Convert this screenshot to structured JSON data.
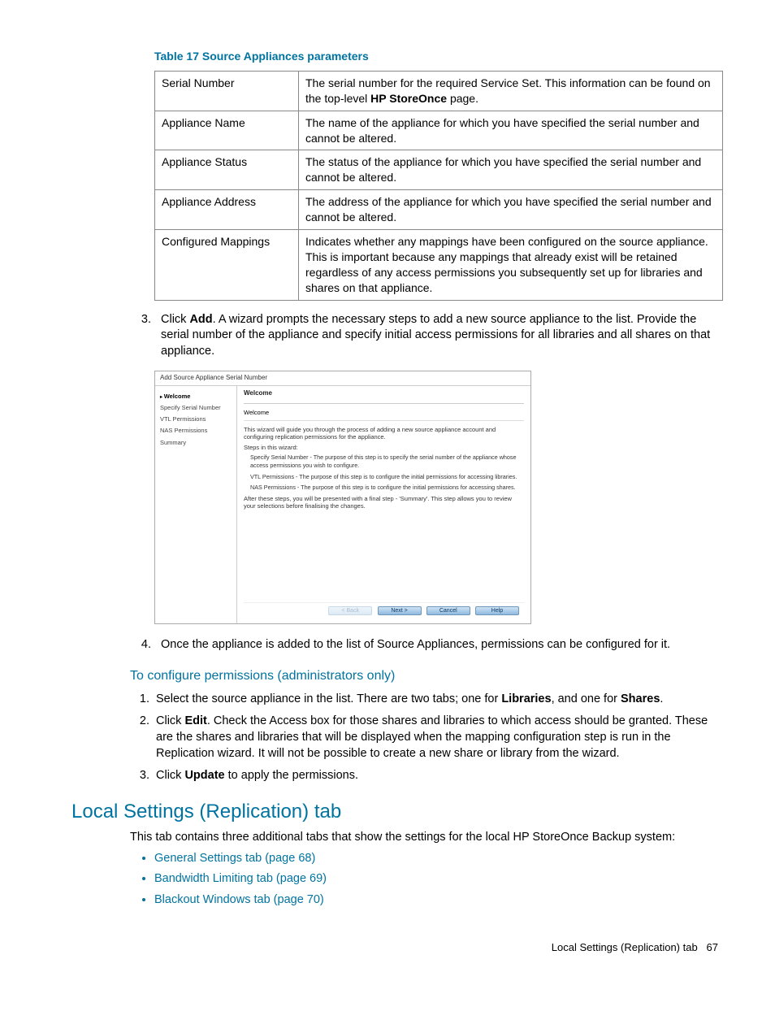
{
  "table": {
    "caption": "Table 17 Source Appliances parameters",
    "rows": [
      {
        "param": "Serial Number",
        "desc_pre": "The serial number for the required Service Set. This information can be found on the top-level ",
        "desc_bold": "HP StoreOnce",
        "desc_post": " page."
      },
      {
        "param": "Appliance Name",
        "desc": "The name of the appliance for which you have specified the serial number and cannot be altered."
      },
      {
        "param": "Appliance Status",
        "desc": "The status of the appliance for which you have specified the serial number and cannot be altered."
      },
      {
        "param": "Appliance Address",
        "desc": "The address of the appliance for which you have specified the serial number and cannot be altered."
      },
      {
        "param": "Configured Mappings",
        "desc": "Indicates whether any mappings have been configured on the source appliance. This is important because any mappings that already exist will be retained regardless of any access permissions you subsequently set up for libraries and shares on that appliance."
      }
    ]
  },
  "step3": {
    "num": "3.",
    "pre": "Click ",
    "bold": "Add",
    "post": ". A wizard prompts the necessary steps to add a new source appliance to the list. Provide the serial number of the appliance and specify initial access permissions for all libraries and all shares on that appliance."
  },
  "wizard": {
    "title": "Add Source Appliance Serial Number",
    "nav": [
      "Welcome",
      "Specify Serial Number",
      "VTL Permissions",
      "NAS Permissions",
      "Summary"
    ],
    "heading": "Welcome",
    "subheading": "Welcome",
    "intro": "This wizard will guide you through the process of adding a new source appliance account and configuring replication permissions for the appliance.",
    "steps_label": "Steps in this wizard:",
    "step_lines": [
      "Specify Serial Number - The purpose of this step is to specify the serial number of the appliance whose access permissions you wish to configure.",
      "VTL Permissions - The purpose of this step is to configure the initial permissions for accessing libraries.",
      "NAS Permissions - The purpose of this step is to configure the initial permissions for accessing shares."
    ],
    "outro": "After these steps, you will be presented with a final step - 'Summary'. This step allows you to review your selections before finalising the changes.",
    "buttons": {
      "back": "< Back",
      "next": "Next >",
      "cancel": "Cancel",
      "help": "Help"
    }
  },
  "step4": {
    "num": "4.",
    "text": "Once the appliance is added to the list of Source Appliances, permissions can be configured for it."
  },
  "configure_perms": {
    "heading": "To configure permissions (administrators only)",
    "step1_pre": "Select the source appliance in the list. There are two tabs; one for ",
    "step1_b1": "Libraries",
    "step1_mid": ", and one for ",
    "step1_b2": "Shares",
    "step1_post": ".",
    "step2_pre": "Click ",
    "step2_b": "Edit",
    "step2_post": ". Check the Access box for those shares and libraries to which access should be granted. These are the shares and libraries that will be displayed when the mapping configuration step is run in the Replication wizard. It will not be possible to create a new share or library from the wizard.",
    "step3_pre": "Click ",
    "step3_b": "Update",
    "step3_post": " to apply the permissions."
  },
  "section": {
    "heading": "Local Settings (Replication) tab",
    "intro": "This tab contains three additional tabs that show the settings for the local HP StoreOnce Backup system:",
    "links": [
      "General Settings tab (page 68)",
      "Bandwidth Limiting tab (page 69)",
      "Blackout Windows tab (page 70)"
    ]
  },
  "footer": {
    "label": "Local Settings (Replication) tab",
    "page": "67"
  }
}
